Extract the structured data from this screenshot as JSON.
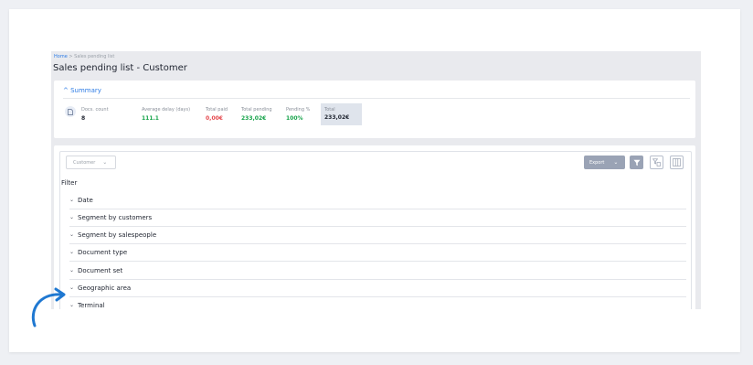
{
  "breadcrumb": {
    "home": "Home",
    "sep": ">",
    "current": "Sales pending list"
  },
  "page_title": "Sales pending list - Customer",
  "summary": {
    "header": "^ Summary",
    "stats": [
      {
        "label": "Docs. count",
        "value": "8",
        "color": "#1f2430"
      },
      {
        "label": "Average delay (days)",
        "value": "111.1",
        "color": "#16a34a"
      },
      {
        "label": "Total paid",
        "value": "0,00€",
        "color": "#e5484d"
      },
      {
        "label": "Total pending",
        "value": "233,02€",
        "color": "#16a34a"
      },
      {
        "label": "Pending %",
        "value": "100%",
        "color": "#16a34a"
      }
    ],
    "total": {
      "label": "Total",
      "value": "233,02€"
    }
  },
  "toolbar": {
    "dropdown": "Customer",
    "export": "Export"
  },
  "filter": {
    "title": "Filter",
    "items": [
      "Date",
      "Segment by customers",
      "Segment by salespeople",
      "Document type",
      "Document set",
      "Geographic area",
      "Terminal"
    ]
  },
  "colors": {
    "accent": "#2c7be5",
    "button": "#9aa3b5",
    "arrow": "#1f78d1"
  }
}
